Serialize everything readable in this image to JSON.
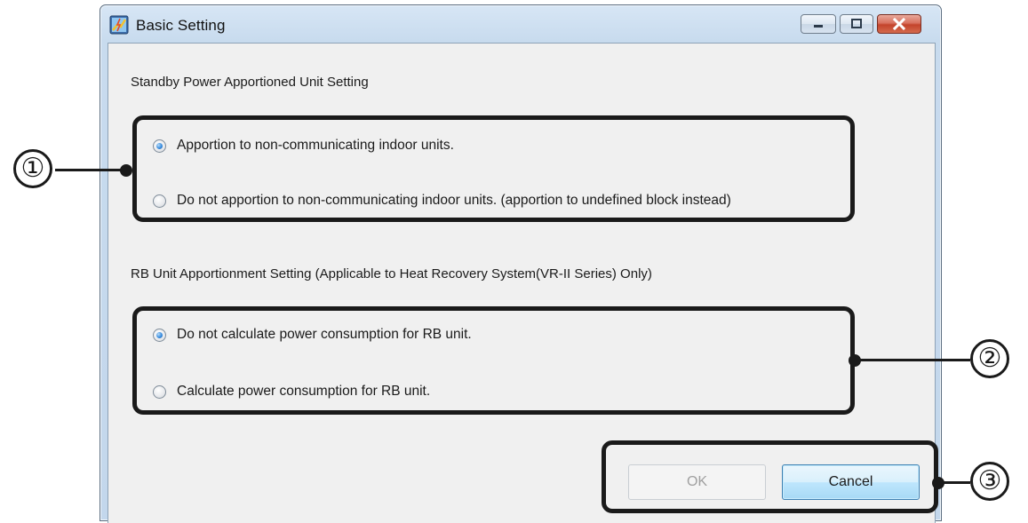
{
  "window": {
    "title": "Basic Setting",
    "icon": "app-settings-icon",
    "controls": [
      "minimize-icon",
      "maximize-icon",
      "close-icon"
    ]
  },
  "standby": {
    "heading": "Standby Power Apportioned Unit Setting",
    "options": [
      {
        "label": "Apportion to non-communicating indoor units.",
        "checked": true
      },
      {
        "label": "Do not apportion to non-communicating indoor units. (apportion to undefined block instead)",
        "checked": false
      }
    ]
  },
  "rb": {
    "heading": "RB Unit Apportionment Setting (Applicable to Heat Recovery System(VR-II Series) Only)",
    "options": [
      {
        "label": "Do not calculate power consumption for RB unit.",
        "checked": true
      },
      {
        "label": "Calculate power consumption for RB unit.",
        "checked": false
      }
    ]
  },
  "buttons": {
    "ok_label": "OK",
    "ok_enabled": false,
    "cancel_label": "Cancel"
  },
  "annotations": {
    "marker_1": "①",
    "marker_2": "②",
    "marker_3": "③"
  },
  "colors": {
    "frame": "#c3d7ec",
    "client": "#f0f0f0",
    "close_button": "#c3442c",
    "radio_selected": "#3a8ee0",
    "annotation": "#1a1a1a"
  }
}
